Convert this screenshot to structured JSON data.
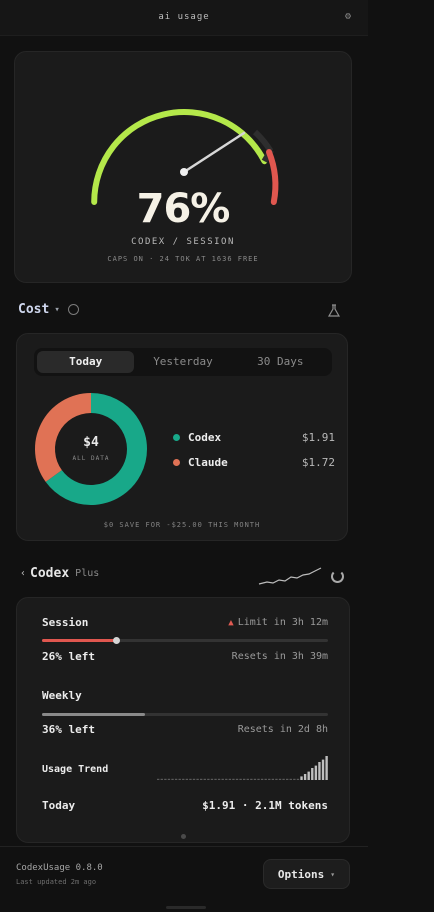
{
  "window": {
    "title": "ai usage",
    "menu_icon": "gear-icon"
  },
  "gauge": {
    "value": "76%",
    "fraction": 0.76,
    "label": "CODEX / SESSION",
    "sub": "CAPS ON · 24 TOK AT 1636 FREE",
    "colors": {
      "green": "#b4e84a",
      "dark": "#2e2e2e",
      "red": "#e0574f"
    }
  },
  "cost": {
    "label": "Cost",
    "tabs": [
      {
        "label": "Today"
      },
      {
        "label": "Yesterday"
      },
      {
        "label": "30 Days"
      }
    ],
    "active_tab": 0,
    "donut": {
      "center_value": "$4",
      "center_sub": "ALL DATA",
      "segments": [
        {
          "name": "Codex",
          "amount": "$1.91",
          "value": 0.65,
          "color": "#18a889"
        },
        {
          "name": "Claude",
          "amount": "$1.72",
          "value": 0.35,
          "color": "#e07255"
        }
      ]
    },
    "footer": "$0 SAVE FOR -$25.00 THIS MONTH"
  },
  "codex": {
    "label": "Codex",
    "plan": "Plus",
    "session": {
      "label": "Session",
      "limit_text": "Limit in 3h 12m",
      "left_text": "26% left",
      "resets_text": "Resets in 3h 39m",
      "fraction_used": 0.26,
      "color": "#e0574f"
    },
    "weekly": {
      "label": "Weekly",
      "left_text": "36% left",
      "resets_text": "Resets in 2d 8h",
      "fraction_used": 0.36,
      "color": "#7a7a7a"
    },
    "usage_trend": {
      "label": "Usage Trend"
    },
    "today": {
      "label": "Today",
      "value": "$1.91 · 2.1M tokens"
    }
  },
  "footer": {
    "app": "CodexUsage 0.8.0",
    "updated": "Last updated 2m ago",
    "options_label": "Options"
  }
}
